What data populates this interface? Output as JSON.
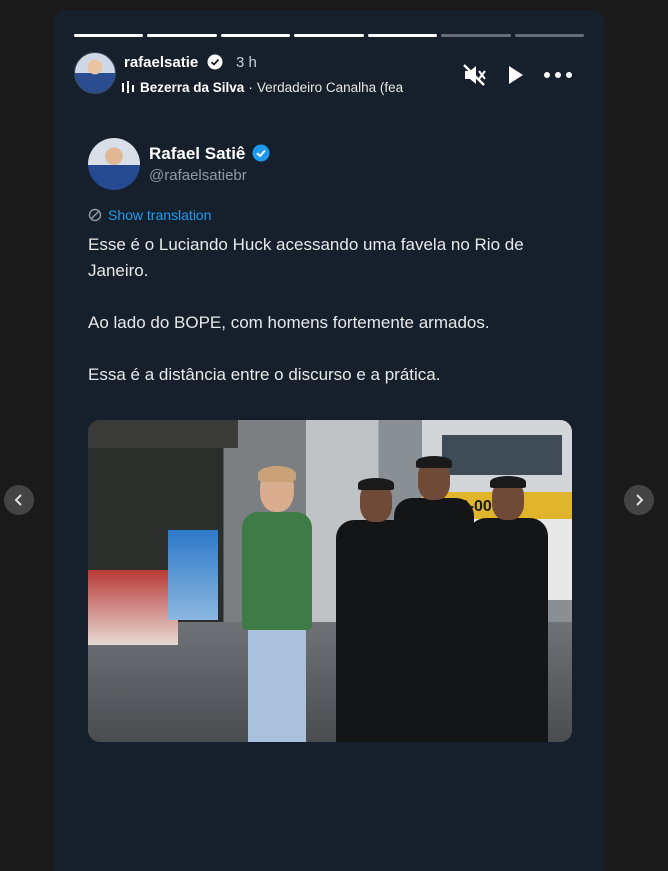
{
  "story": {
    "progress_total": 7,
    "progress_done": 5,
    "username": "rafaelsatie",
    "time_ago": "3 h",
    "music_icon": "music-bars-icon",
    "music_artist": "Bezerra da Silva",
    "music_separator": "·",
    "music_song": "Verdadeiro Canalha (fea"
  },
  "tweet": {
    "name": "Rafael Satiê",
    "handle": "@rafaelsatiebr",
    "show_translation": "Show translation",
    "paragraphs": [
      "Esse é o Luciando Huck acessando uma favela no Rio de Janeiro.",
      "Ao lado do BOPE, com homens fortemente armados.",
      "Essa é a distância entre o discurso e a prática."
    ]
  },
  "photo": {
    "bus_number": "266-000"
  },
  "colors": {
    "panel": "#16202d",
    "accent": "#1d9bf0",
    "text": "#e7e9ea",
    "muted": "#8b98a5"
  }
}
